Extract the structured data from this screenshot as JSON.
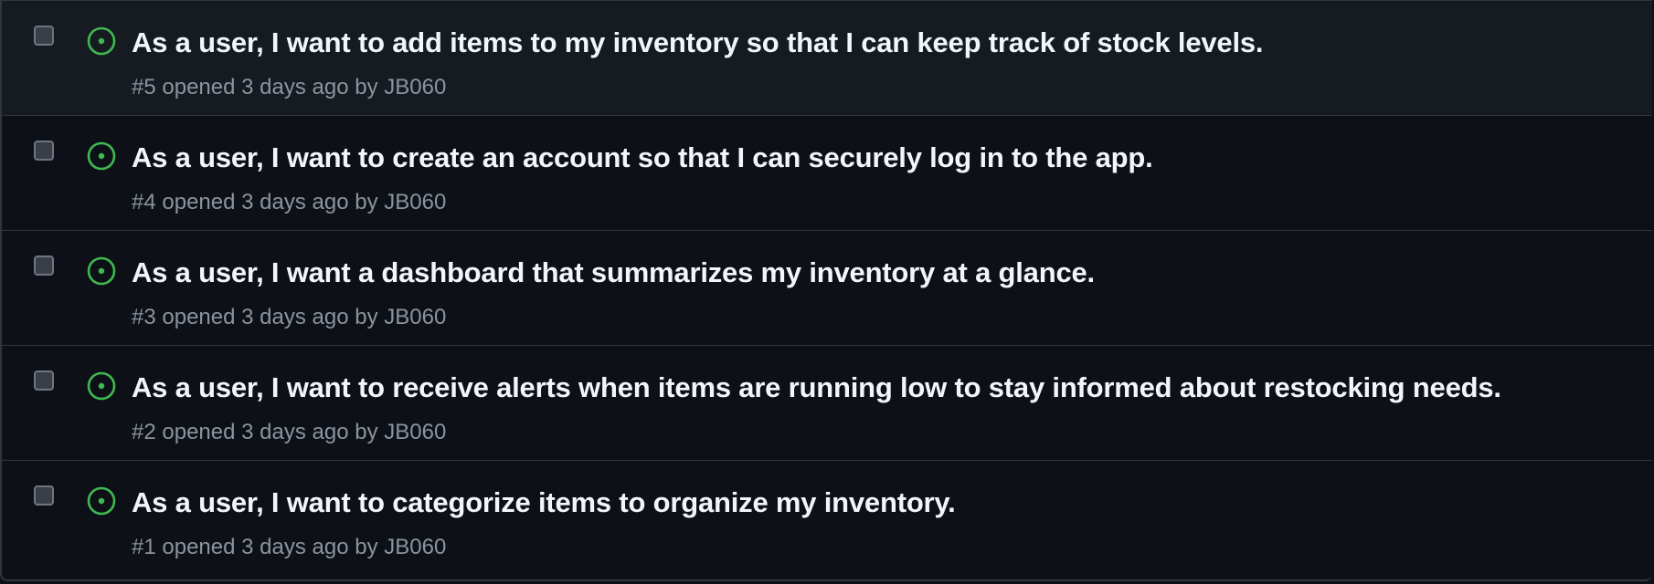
{
  "issues": [
    {
      "title": "As a user, I want to add items to my inventory so that I can keep track of stock levels.",
      "number": "#5",
      "opened": "opened 3 days ago by",
      "author": "JB060"
    },
    {
      "title": "As a user, I want to create an account so that I can securely log in to the app.",
      "number": "#4",
      "opened": "opened 3 days ago by",
      "author": "JB060"
    },
    {
      "title": "As a user, I want a dashboard that summarizes my inventory at a glance.",
      "number": "#3",
      "opened": "opened 3 days ago by",
      "author": "JB060"
    },
    {
      "title": "As a user, I want to receive alerts when items are running low to stay informed about restocking needs.",
      "number": "#2",
      "opened": "opened 3 days ago by",
      "author": "JB060"
    },
    {
      "title": "As a user, I want to categorize items to organize my inventory.",
      "number": "#1",
      "opened": "opened 3 days ago by",
      "author": "JB060"
    }
  ],
  "colors": {
    "background": "#0d1117",
    "hover_background": "#161b22",
    "border": "#30363d",
    "title": "#f0f6fc",
    "meta": "#8b949e",
    "open_status": "#3fb950"
  },
  "icons": {
    "status": "issue-opened-icon",
    "select": "checkbox"
  }
}
